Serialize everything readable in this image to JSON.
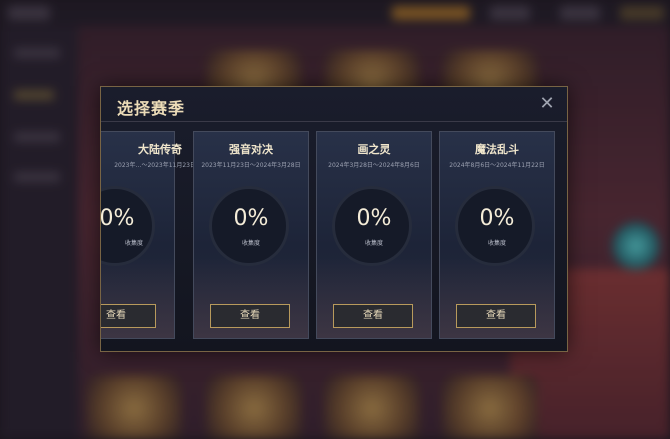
{
  "modal": {
    "title": "选择赛季",
    "close_icon": "close-icon"
  },
  "seasons": [
    {
      "name": "大陆传奇",
      "date": "2023年…〜2023年11月23日",
      "progress": "0%",
      "progress_label": "收集度",
      "button": "查看"
    },
    {
      "name": "强音对决",
      "date": "2023年11月23日〜2024年3月28日",
      "progress": "0%",
      "progress_label": "收集度",
      "button": "查看"
    },
    {
      "name": "画之灵",
      "date": "2024年3月28日〜2024年8月6日",
      "progress": "0%",
      "progress_label": "收集度",
      "button": "查看"
    },
    {
      "name": "魔法乱斗",
      "date": "2024年8月6日〜2024年11月22日",
      "progress": "0%",
      "progress_label": "收集度",
      "button": "查看"
    }
  ],
  "colors": {
    "accent_gold": "#b89a5c",
    "modal_bg": "#171a26",
    "title_text": "#ecdcb8"
  }
}
